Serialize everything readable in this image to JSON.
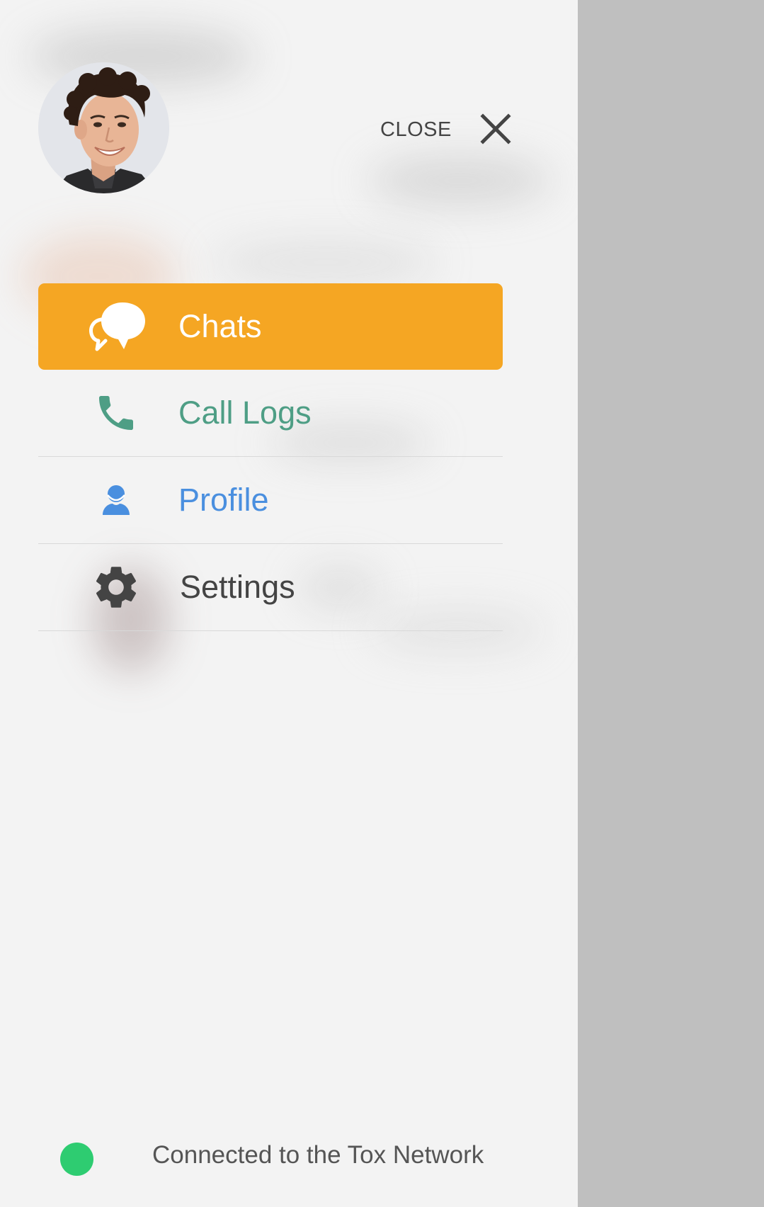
{
  "colors": {
    "drawer_background": "#f3f3f3",
    "overlay_background": "#bfbfbf",
    "active_item": "#f5a623",
    "call_logs": "#4e9e85",
    "profile": "#4a8fdf",
    "settings": "#444444",
    "status_online": "#2ecc71"
  },
  "header": {
    "avatar_icon": "user-avatar-photo",
    "close_label": "CLOSE",
    "close_icon": "close-icon"
  },
  "menu": {
    "items": [
      {
        "label": "Chats",
        "icon": "chat-bubbles-icon",
        "active": true
      },
      {
        "label": "Call Logs",
        "icon": "phone-icon",
        "active": false
      },
      {
        "label": "Profile",
        "icon": "user-icon",
        "active": false
      },
      {
        "label": "Settings",
        "icon": "gear-icon",
        "active": false
      }
    ]
  },
  "status": {
    "text": "Connected to the Tox Network",
    "state": "online"
  }
}
